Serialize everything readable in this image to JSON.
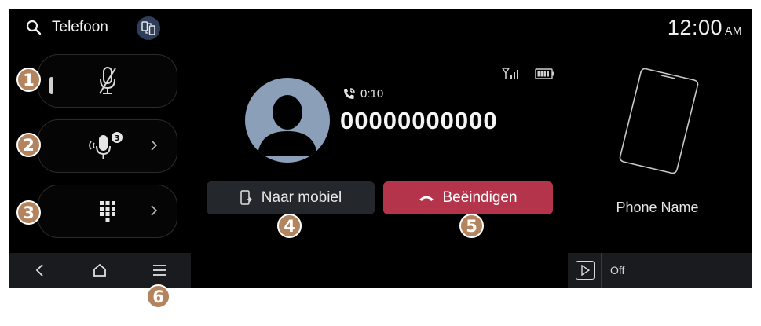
{
  "header": {
    "title": "Telefoon",
    "clock_time": "12:00",
    "clock_ampm": "AM"
  },
  "side_buttons": [
    {
      "name": "mute-microphone",
      "icon": "mic-muted-icon"
    },
    {
      "name": "voice-recognition",
      "icon": "microphone-icon",
      "count": "3"
    },
    {
      "name": "dial-pad",
      "icon": "keypad-icon"
    }
  ],
  "callouts": [
    "1",
    "2",
    "3",
    "4",
    "5",
    "6"
  ],
  "call": {
    "duration": "0:10",
    "number": "00000000000"
  },
  "actions": {
    "to_mobile_label": "Naar mobiel",
    "end_call_label": "Beëindigen"
  },
  "device": {
    "phone_name": "Phone Name"
  },
  "media": {
    "status": "Off"
  },
  "colors": {
    "end_call": "#b3344b",
    "avatar": "#8b9fb8",
    "callout_badge": "#b3845e"
  }
}
